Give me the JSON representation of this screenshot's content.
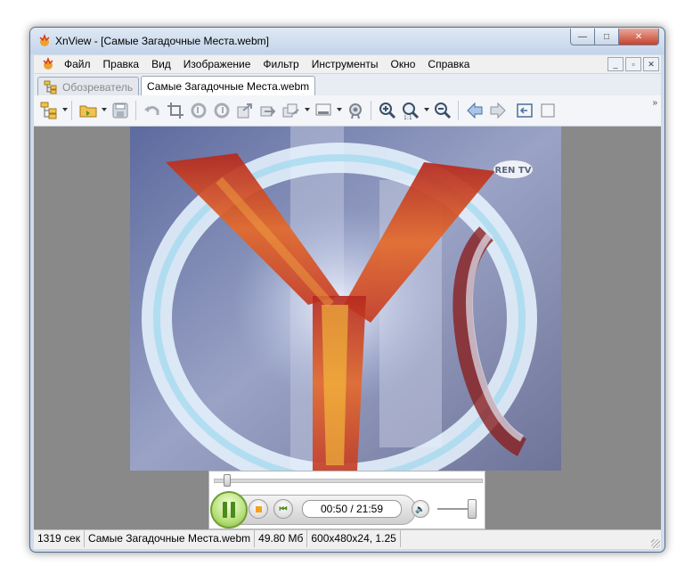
{
  "window": {
    "title": "XnView - [Самые Загадочные Места.webm]",
    "caption_buttons": {
      "minimize": "—",
      "maximize": "□",
      "close": "✕"
    }
  },
  "menu": {
    "items": [
      "Файл",
      "Правка",
      "Вид",
      "Изображение",
      "Фильтр",
      "Инструменты",
      "Окно",
      "Справка"
    ],
    "mdi_buttons": [
      "_",
      "▫",
      "✕"
    ]
  },
  "tabs": [
    {
      "label": "Обозреватель",
      "active": false
    },
    {
      "label": "Самые Загадочные Места.webm",
      "active": true
    }
  ],
  "toolbar": {
    "buttons": [
      "browser-icon",
      "open-folder-icon",
      "save-icon",
      "undo-icon",
      "crop-icon",
      "rotate-left-icon",
      "rotate-right-icon",
      "export-icon",
      "convert-icon",
      "batch-icon",
      "display-icon",
      "settings-icon",
      "zoom-in-icon",
      "zoom-1to1-icon",
      "zoom-out-icon",
      "previous-icon",
      "next-icon",
      "fullscreen-icon"
    ],
    "overflow_label": "»"
  },
  "player": {
    "time": "00:50 / 21:59",
    "seek_progress": 0.038,
    "volume": 0.95
  },
  "status": {
    "cells": [
      "1319 сек",
      "Самые Загадочные Места.webm",
      "49.80 Мб",
      "600x480x24, 1.25"
    ]
  },
  "image": {
    "channel_logo": "REN TV"
  },
  "colors": {
    "accent": "#4b8a1e",
    "titlebar": "#c3d4e9",
    "viewer_bg": "#898989"
  }
}
